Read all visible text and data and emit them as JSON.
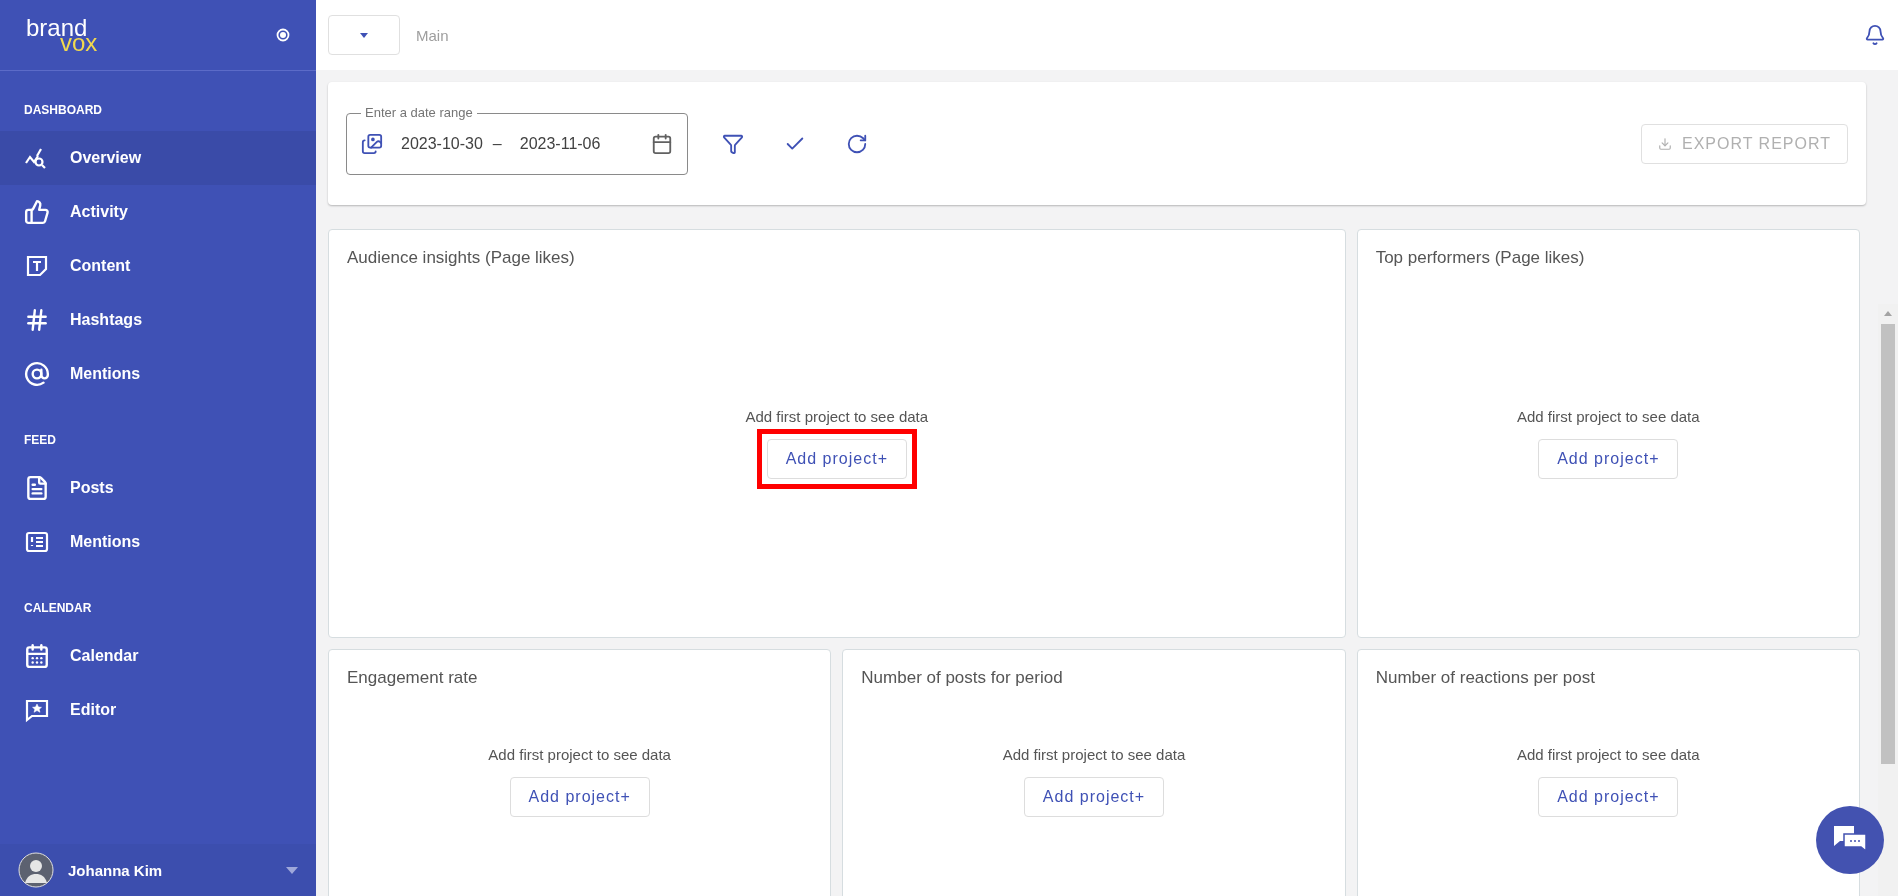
{
  "sidebar": {
    "logo": {
      "word_top": "brand",
      "word_bottom": "vox"
    },
    "sections": [
      {
        "title": "DASHBOARD",
        "items": [
          {
            "label": "Overview",
            "kind": "overview",
            "selected": true
          },
          {
            "label": "Activity",
            "kind": "thumb",
            "selected": false
          },
          {
            "label": "Content",
            "kind": "text",
            "selected": false
          },
          {
            "label": "Hashtags",
            "kind": "hash",
            "selected": false
          },
          {
            "label": "Mentions",
            "kind": "at",
            "selected": false
          }
        ]
      },
      {
        "title": "FEED",
        "items": [
          {
            "label": "Posts",
            "kind": "doc",
            "selected": false
          },
          {
            "label": "Mentions",
            "kind": "list",
            "selected": false
          }
        ]
      },
      {
        "title": "CALENDAR",
        "items": [
          {
            "label": "Calendar",
            "kind": "calendar",
            "selected": false
          },
          {
            "label": "Editor",
            "kind": "star",
            "selected": false
          }
        ]
      }
    ],
    "user": {
      "name": "Johanna Kim"
    }
  },
  "topbar": {
    "breadcrumb": "Main"
  },
  "filters": {
    "date_range": {
      "label": "Enter a date range",
      "start": "2023-10-30",
      "separator": "–",
      "end": "2023-11-06"
    },
    "export_button": {
      "label": "EXPORT REPORT",
      "disabled": true
    }
  },
  "cards": [
    {
      "title": "Audience insights (Page likes)",
      "message": "Add first project to see data",
      "button": "Add project+",
      "highlighted": true
    },
    {
      "title": "Top performers (Page likes)",
      "message": "Add first project to see data",
      "button": "Add project+",
      "highlighted": false
    },
    {
      "title": "Engagement rate",
      "message": "Add first project to see data",
      "button": "Add project+",
      "highlighted": false
    },
    {
      "title": "Number of posts for period",
      "message": "Add first project to see data",
      "button": "Add project+",
      "highlighted": false
    },
    {
      "title": "Number of reactions per post",
      "message": "Add first project to see data",
      "button": "Add project+",
      "highlighted": false
    }
  ]
}
